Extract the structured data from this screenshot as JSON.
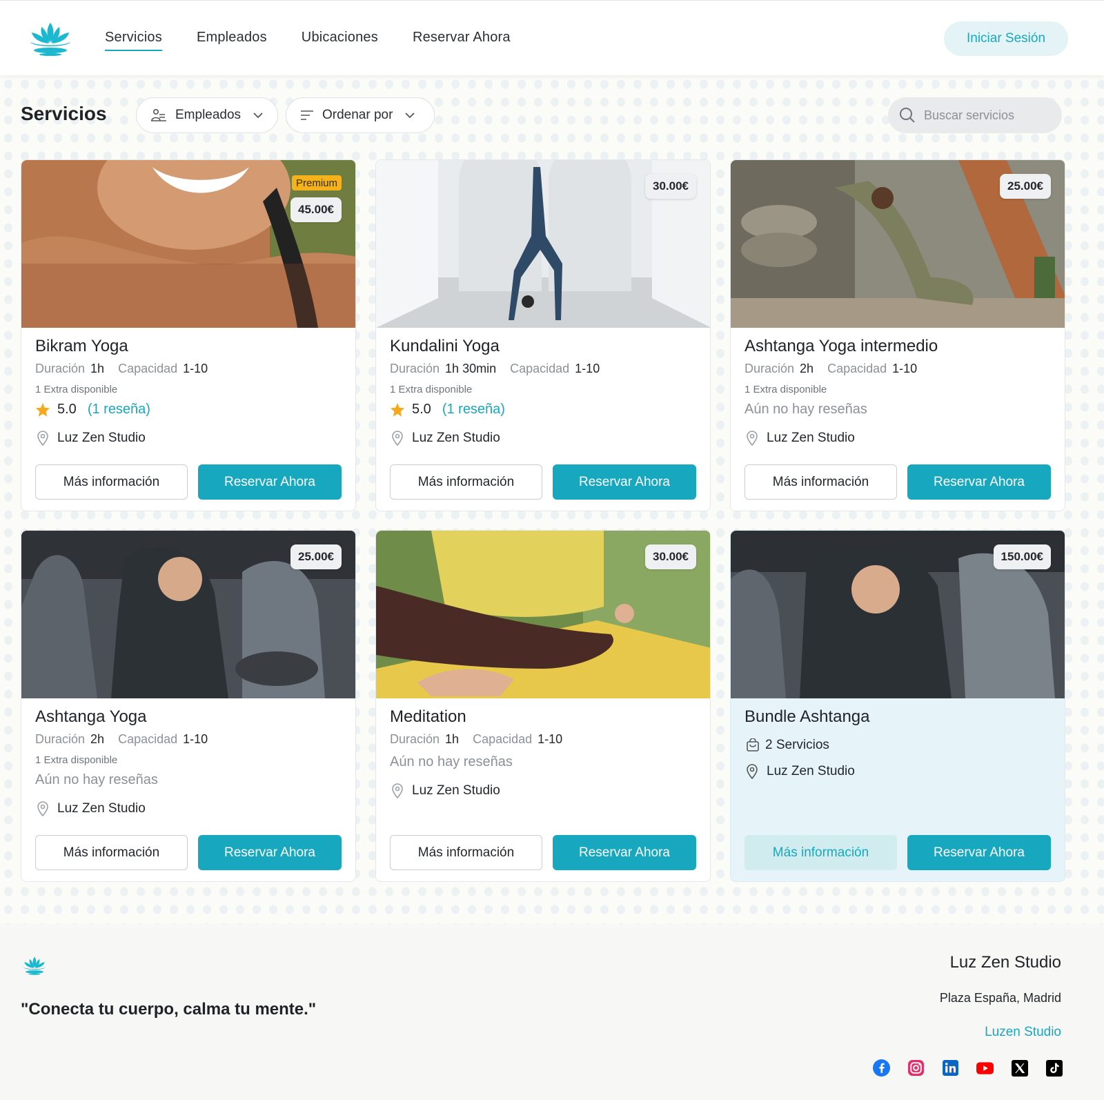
{
  "nav": {
    "items": [
      "Servicios",
      "Empleados",
      "Ubicaciones",
      "Reservar Ahora"
    ],
    "active": "Servicios",
    "login": "Iniciar Sesión"
  },
  "toolbar": {
    "title": "Servicios",
    "employees_filter": "Empleados",
    "sort": "Ordenar por",
    "search_placeholder": "Buscar servicios"
  },
  "labels": {
    "duration": "Duración",
    "capacity": "Capacidad",
    "more_info": "Más información",
    "book_now": "Reservar Ahora",
    "no_reviews": "Aún no hay reseñas",
    "premium": "Premium"
  },
  "services": [
    {
      "title": "Bikram Yoga",
      "price": "45.00€",
      "premium": true,
      "duration": "1h",
      "capacity": "1-10",
      "extra": "1 Extra disponible",
      "rating": "5.0",
      "reviews": "(1 reseña)",
      "location": "Luz Zen Studio"
    },
    {
      "title": "Kundalini Yoga",
      "price": "30.00€",
      "premium": false,
      "duration": "1h 30min",
      "capacity": "1-10",
      "extra": "1 Extra disponible",
      "rating": "5.0",
      "reviews": "(1 reseña)",
      "location": "Luz Zen Studio"
    },
    {
      "title": "Ashtanga Yoga intermedio",
      "price": "25.00€",
      "premium": false,
      "duration": "2h",
      "capacity": "1-10",
      "extra": "1 Extra disponible",
      "rating": null,
      "reviews": null,
      "location": "Luz Zen Studio"
    },
    {
      "title": "Ashtanga Yoga",
      "price": "25.00€",
      "premium": false,
      "duration": "2h",
      "capacity": "1-10",
      "extra": "1 Extra disponible",
      "rating": null,
      "reviews": null,
      "location": "Luz Zen Studio"
    },
    {
      "title": "Meditation",
      "price": "30.00€",
      "premium": false,
      "duration": "1h",
      "capacity": "1-10",
      "extra": null,
      "rating": null,
      "reviews": null,
      "location": "Luz Zen Studio"
    },
    {
      "title": "Bundle Ashtanga",
      "price": "150.00€",
      "premium": false,
      "bundle": true,
      "services_count": "2 Servicios",
      "location": "Luz Zen Studio"
    }
  ],
  "footer": {
    "quote": "\"Conecta tu cuerpo, calma tu mente.\"",
    "studio": "Luz Zen Studio",
    "address": "Plaza España, Madrid",
    "link": "Luzen Studio",
    "socials": [
      "facebook-icon",
      "instagram-icon",
      "linkedin-icon",
      "youtube-icon",
      "x-icon",
      "tiktok-icon"
    ]
  },
  "colors": {
    "accent": "#17a8c0",
    "star": "#f6a91a",
    "premium": "#f6b21a"
  }
}
